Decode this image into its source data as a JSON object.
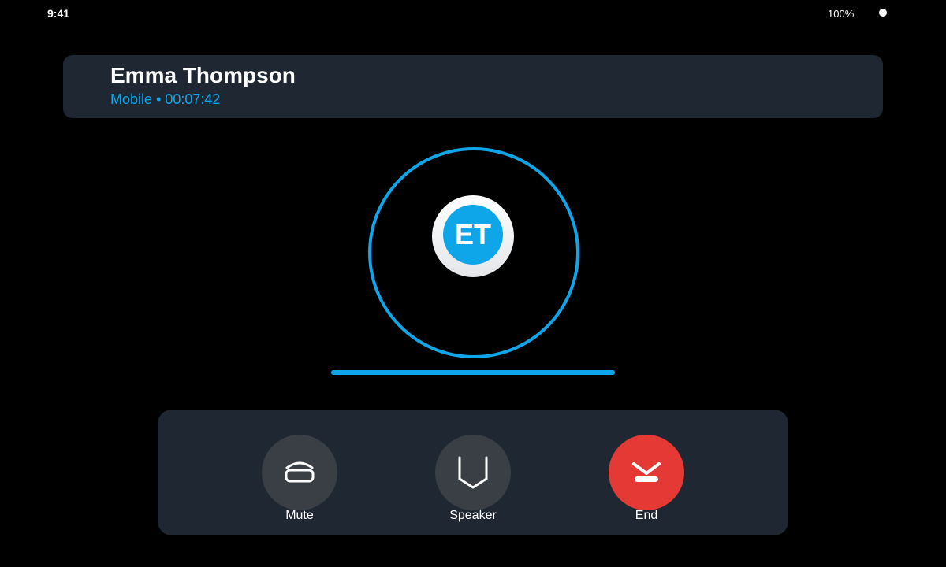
{
  "status_bar": {
    "time": "9:41",
    "battery": "100%"
  },
  "call": {
    "caller_name": "Emma Thompson",
    "call_info": "Mobile • 00:07:42",
    "initials": "ET"
  },
  "audio_level": 1.0,
  "controls": {
    "mute_label": "Mute",
    "speaker_label": "Speaker",
    "end_label": "End"
  },
  "icons": {
    "mute": "handset-icon",
    "speaker": "shield-speaker-icon",
    "end": "hang-up-icon"
  },
  "colors": {
    "accent": "#0ea5e9",
    "panel": "#1f2733",
    "control_bg": "#3a3f46",
    "end_red": "#e53935"
  }
}
